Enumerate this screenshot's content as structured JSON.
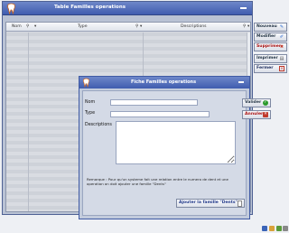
{
  "window": {
    "title": "Table Familles operations"
  },
  "grid": {
    "columns": [
      "Nom",
      "Type",
      "Descriptions"
    ]
  },
  "side_buttons": {
    "nouveau": "Nouveau",
    "modifier": "Modifier",
    "supprimer": "Supprimer",
    "imprimer": "Imprimer",
    "fermer": "Fermer"
  },
  "modal": {
    "title": "Fiche Familles operations",
    "fields": {
      "nom_label": "Nom",
      "type_label": "Type",
      "desc_label": "Descriptions",
      "nom_value": "",
      "type_value": "",
      "desc_value": ""
    },
    "valider": "Valider",
    "annuler": "Annuler",
    "remarque": "Remarque : Pour qu'un systeme fait une relation entre le numero de dent et une operation on doit ajouter une famille \"Dents\"",
    "ajouter": "Ajouter la famille \"Dents\""
  },
  "colors": {
    "titlebar": "#4a66b8",
    "accent_green": "#2a9a2a",
    "accent_red": "#c0392b"
  }
}
